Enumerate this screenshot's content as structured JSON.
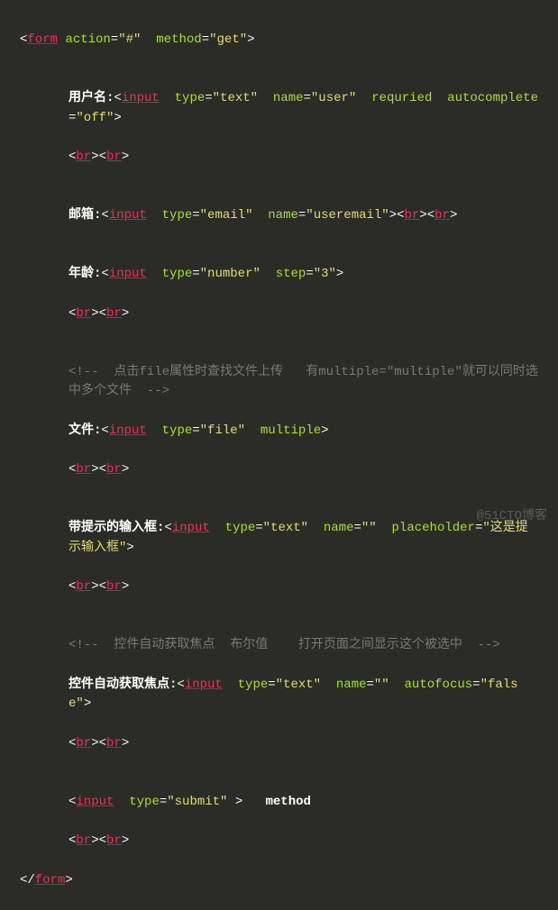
{
  "code": {
    "l1": {
      "open": "<",
      "tag": "form",
      "sp": " ",
      "a1": "action",
      "eq": "=",
      "v1": "\"#\"",
      "sp2": "  ",
      "a2": "method",
      "eq2": "=",
      "v2": "\"get\"",
      "close": ">"
    },
    "l2": {
      "txt": "用户名:",
      "open": "<",
      "tag": "input",
      "sp": "  ",
      "a1": "type",
      "eq": "=",
      "v1": "\"text\"",
      "sp2": "  ",
      "a2": "name",
      "eq2": "=",
      "v2": "\"user\"",
      "sp3": "  ",
      "a3": "requried",
      "sp4": "  ",
      "a4": "autocomplete",
      "eq4": "=",
      "v4": "\"off\"",
      "close": ">"
    },
    "brbr": {
      "o1": "<",
      "t1": "br",
      "c1": ">",
      "o2": "<",
      "t2": "br",
      "c2": ">"
    },
    "l3": {
      "txt": "邮箱:",
      "open": "<",
      "tag": "input",
      "sp": "  ",
      "a1": "type",
      "eq": "=",
      "v1": "\"email\"",
      "sp2": "  ",
      "a2": "name",
      "eq2": "=",
      "v2": "\"useremail\"",
      "close": ">",
      "bo1": "<",
      "bt1": "br",
      "bc1": ">",
      "bo2": "<",
      "bt2": "br",
      "bc2": ">"
    },
    "l4": {
      "txt": "年龄:",
      "open": "<",
      "tag": "input",
      "sp": "  ",
      "a1": "type",
      "eq": "=",
      "v1": "\"number\"",
      "sp2": "  ",
      "a2": "step",
      "eq2": "=",
      "v2": "\"3\"",
      "close": ">"
    },
    "c1": "<!--  点击file属性时查找文件上传   有multiple=\"multiple\"就可以同时选中多个文件  -->",
    "l5": {
      "txt": "文件:",
      "open": "<",
      "tag": "input",
      "sp": "  ",
      "a1": "type",
      "eq": "=",
      "v1": "\"file\"",
      "sp2": "  ",
      "a2": "multiple",
      "close": ">"
    },
    "l6": {
      "txt": "带提示的输入框:",
      "open": "<",
      "tag": "input",
      "sp": "  ",
      "a1": "type",
      "eq": "=",
      "v1": "\"text\"",
      "sp2": "  ",
      "a2": "name",
      "eq2": "=",
      "v2": "\"\"",
      "sp3": "  ",
      "a3": "placeholder",
      "eq3": "=",
      "v3": "\"这是提示输入框\"",
      "close": ">"
    },
    "c2": "<!--  控件自动获取焦点  布尔值    打开页面之间显示这个被选中  -->",
    "l7": {
      "txt": "控件自动获取焦点:",
      "open": "<",
      "tag": "input",
      "sp": "  ",
      "a1": "type",
      "eq": "=",
      "v1": "\"text\"",
      "sp2": "  ",
      "a2": "name",
      "eq2": "=",
      "v2": "\"\"",
      "sp3": "  ",
      "a3": "autofocus",
      "eq3": "=",
      "v3": "\"false\"",
      "close": ">"
    },
    "l8": {
      "open": "<",
      "tag": "input",
      "sp": "  ",
      "a1": "type",
      "eq": "=",
      "v1": "\"submit\"",
      "sp2": " ",
      "close": ">",
      "after": "   method"
    },
    "l9": {
      "open": "</",
      "tag": "form",
      "close": ">"
    }
  },
  "watermark": "@51CTO博客"
}
